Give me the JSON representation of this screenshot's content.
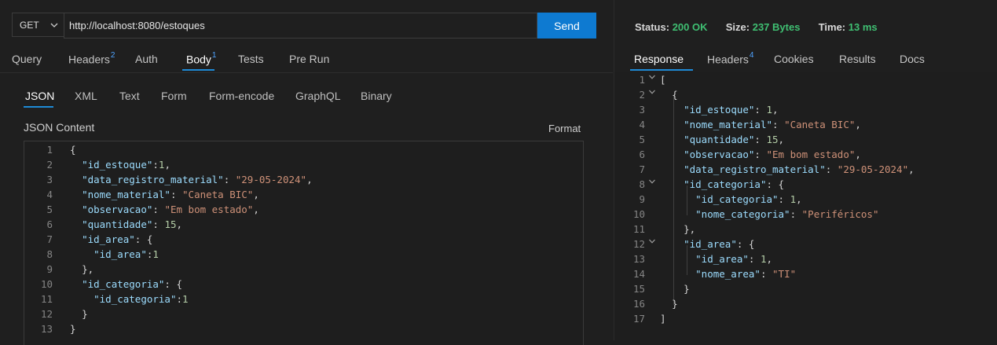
{
  "request": {
    "method": "GET",
    "url": "http://localhost:8080/estoques",
    "send_label": "Send",
    "tabs": [
      {
        "label": "Query",
        "badge": ""
      },
      {
        "label": "Headers",
        "badge": "2"
      },
      {
        "label": "Auth",
        "badge": ""
      },
      {
        "label": "Body",
        "badge": "1"
      },
      {
        "label": "Tests",
        "badge": ""
      },
      {
        "label": "Pre Run",
        "badge": ""
      }
    ],
    "active_tab": "Body",
    "body_types": [
      "JSON",
      "XML",
      "Text",
      "Form",
      "Form-encode",
      "GraphQL",
      "Binary"
    ],
    "active_body_type": "JSON",
    "content_label": "JSON Content",
    "format_label": "Format",
    "body_lines": [
      "{",
      "  \"id_estoque\":1,",
      "  \"data_registro_material\": \"29-05-2024\",",
      "  \"nome_material\": \"Caneta BIC\",",
      "  \"observacao\": \"Em bom estado\",",
      "  \"quantidade\": 15,",
      "  \"id_area\": {",
      "    \"id_area\":1",
      "  },",
      "  \"id_categoria\": {",
      "    \"id_categoria\":1",
      "  }",
      "}"
    ]
  },
  "response": {
    "status_label": "Status:",
    "status_value": "200 OK",
    "size_label": "Size:",
    "size_value": "237 Bytes",
    "time_label": "Time:",
    "time_value": "13 ms",
    "tabs": [
      {
        "label": "Response",
        "badge": ""
      },
      {
        "label": "Headers",
        "badge": "4"
      },
      {
        "label": "Cookies",
        "badge": ""
      },
      {
        "label": "Results",
        "badge": ""
      },
      {
        "label": "Docs",
        "badge": ""
      }
    ],
    "active_tab": "Response",
    "body_lines": [
      "[",
      "  {",
      "    \"id_estoque\": 1,",
      "    \"nome_material\": \"Caneta BIC\",",
      "    \"quantidade\": 15,",
      "    \"observacao\": \"Em bom estado\",",
      "    \"data_registro_material\": \"29-05-2024\",",
      "    \"id_categoria\": {",
      "      \"id_categoria\": 1,",
      "      \"nome_categoria\": \"Periféricos\"",
      "    },",
      "    \"id_area\": {",
      "      \"id_area\": 1,",
      "      \"nome_area\": \"TI\"",
      "    }",
      "  }",
      "]"
    ],
    "fold_lines": [
      1,
      2,
      8,
      12
    ]
  },
  "colors": {
    "accent": "#0e7ad1",
    "status_ok": "#3fbf72",
    "json_key": "#9cdcfe",
    "json_string": "#ce9178",
    "json_number": "#b5cea8"
  }
}
